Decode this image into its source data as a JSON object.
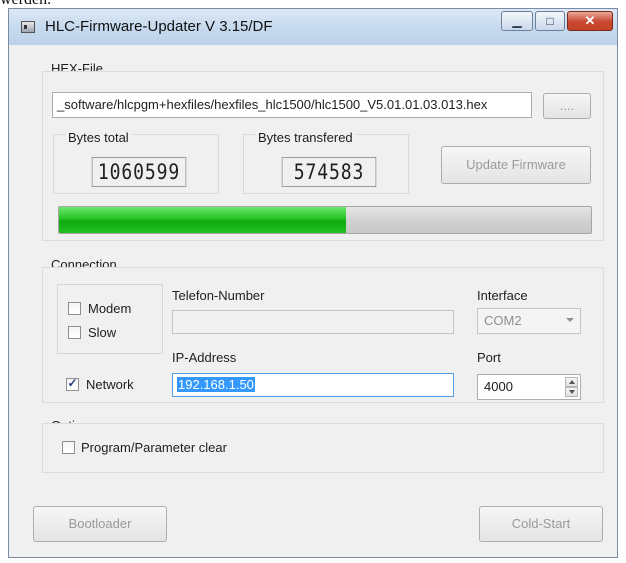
{
  "background_text": "werden.",
  "window": {
    "title": "HLC-Firmware-Updater V 3.15/DF",
    "app_icon": "app-window-icon",
    "caption_buttons": {
      "minimize_glyph": "▁",
      "maximize_glyph": "□",
      "close_glyph": "✕"
    }
  },
  "hex_file": {
    "group_label": "HEX-File",
    "path": "_software/hlcpgm+hexfiles/hexfiles_hlc1500/hlc1500_V5.01.01.03.013.hex",
    "browse_label": "....",
    "bytes_total_label": "Bytes total",
    "bytes_total_value": "1060599",
    "bytes_transfered_label": "Bytes transfered",
    "bytes_transfered_value": "574583",
    "update_button_label": "Update Firmware",
    "progress_fraction": 0.54,
    "progress_color": "#1fb81f"
  },
  "connection": {
    "group_label": "Connection",
    "modem_label": "Modem",
    "modem_checked": "",
    "slow_label": "Slow",
    "slow_checked": "",
    "telefon_label": "Telefon-Number",
    "telefon_value": "",
    "interface_label": "Interface",
    "interface_value": "COM2",
    "ip_label": "IP-Address",
    "ip_value": "192.168.1.50",
    "port_label": "Port",
    "port_value": "4000",
    "network_label": "Network",
    "network_checked": "✓"
  },
  "options": {
    "group_label": "Options",
    "clear_label": "Program/Parameter clear",
    "clear_checked": ""
  },
  "buttons": {
    "bootloader_label": "Bootloader",
    "coldstart_label": "Cold-Start"
  },
  "colors": {
    "selection": "#3399ff",
    "titlebar": "#c7daee",
    "close_button": "#c8472f"
  }
}
